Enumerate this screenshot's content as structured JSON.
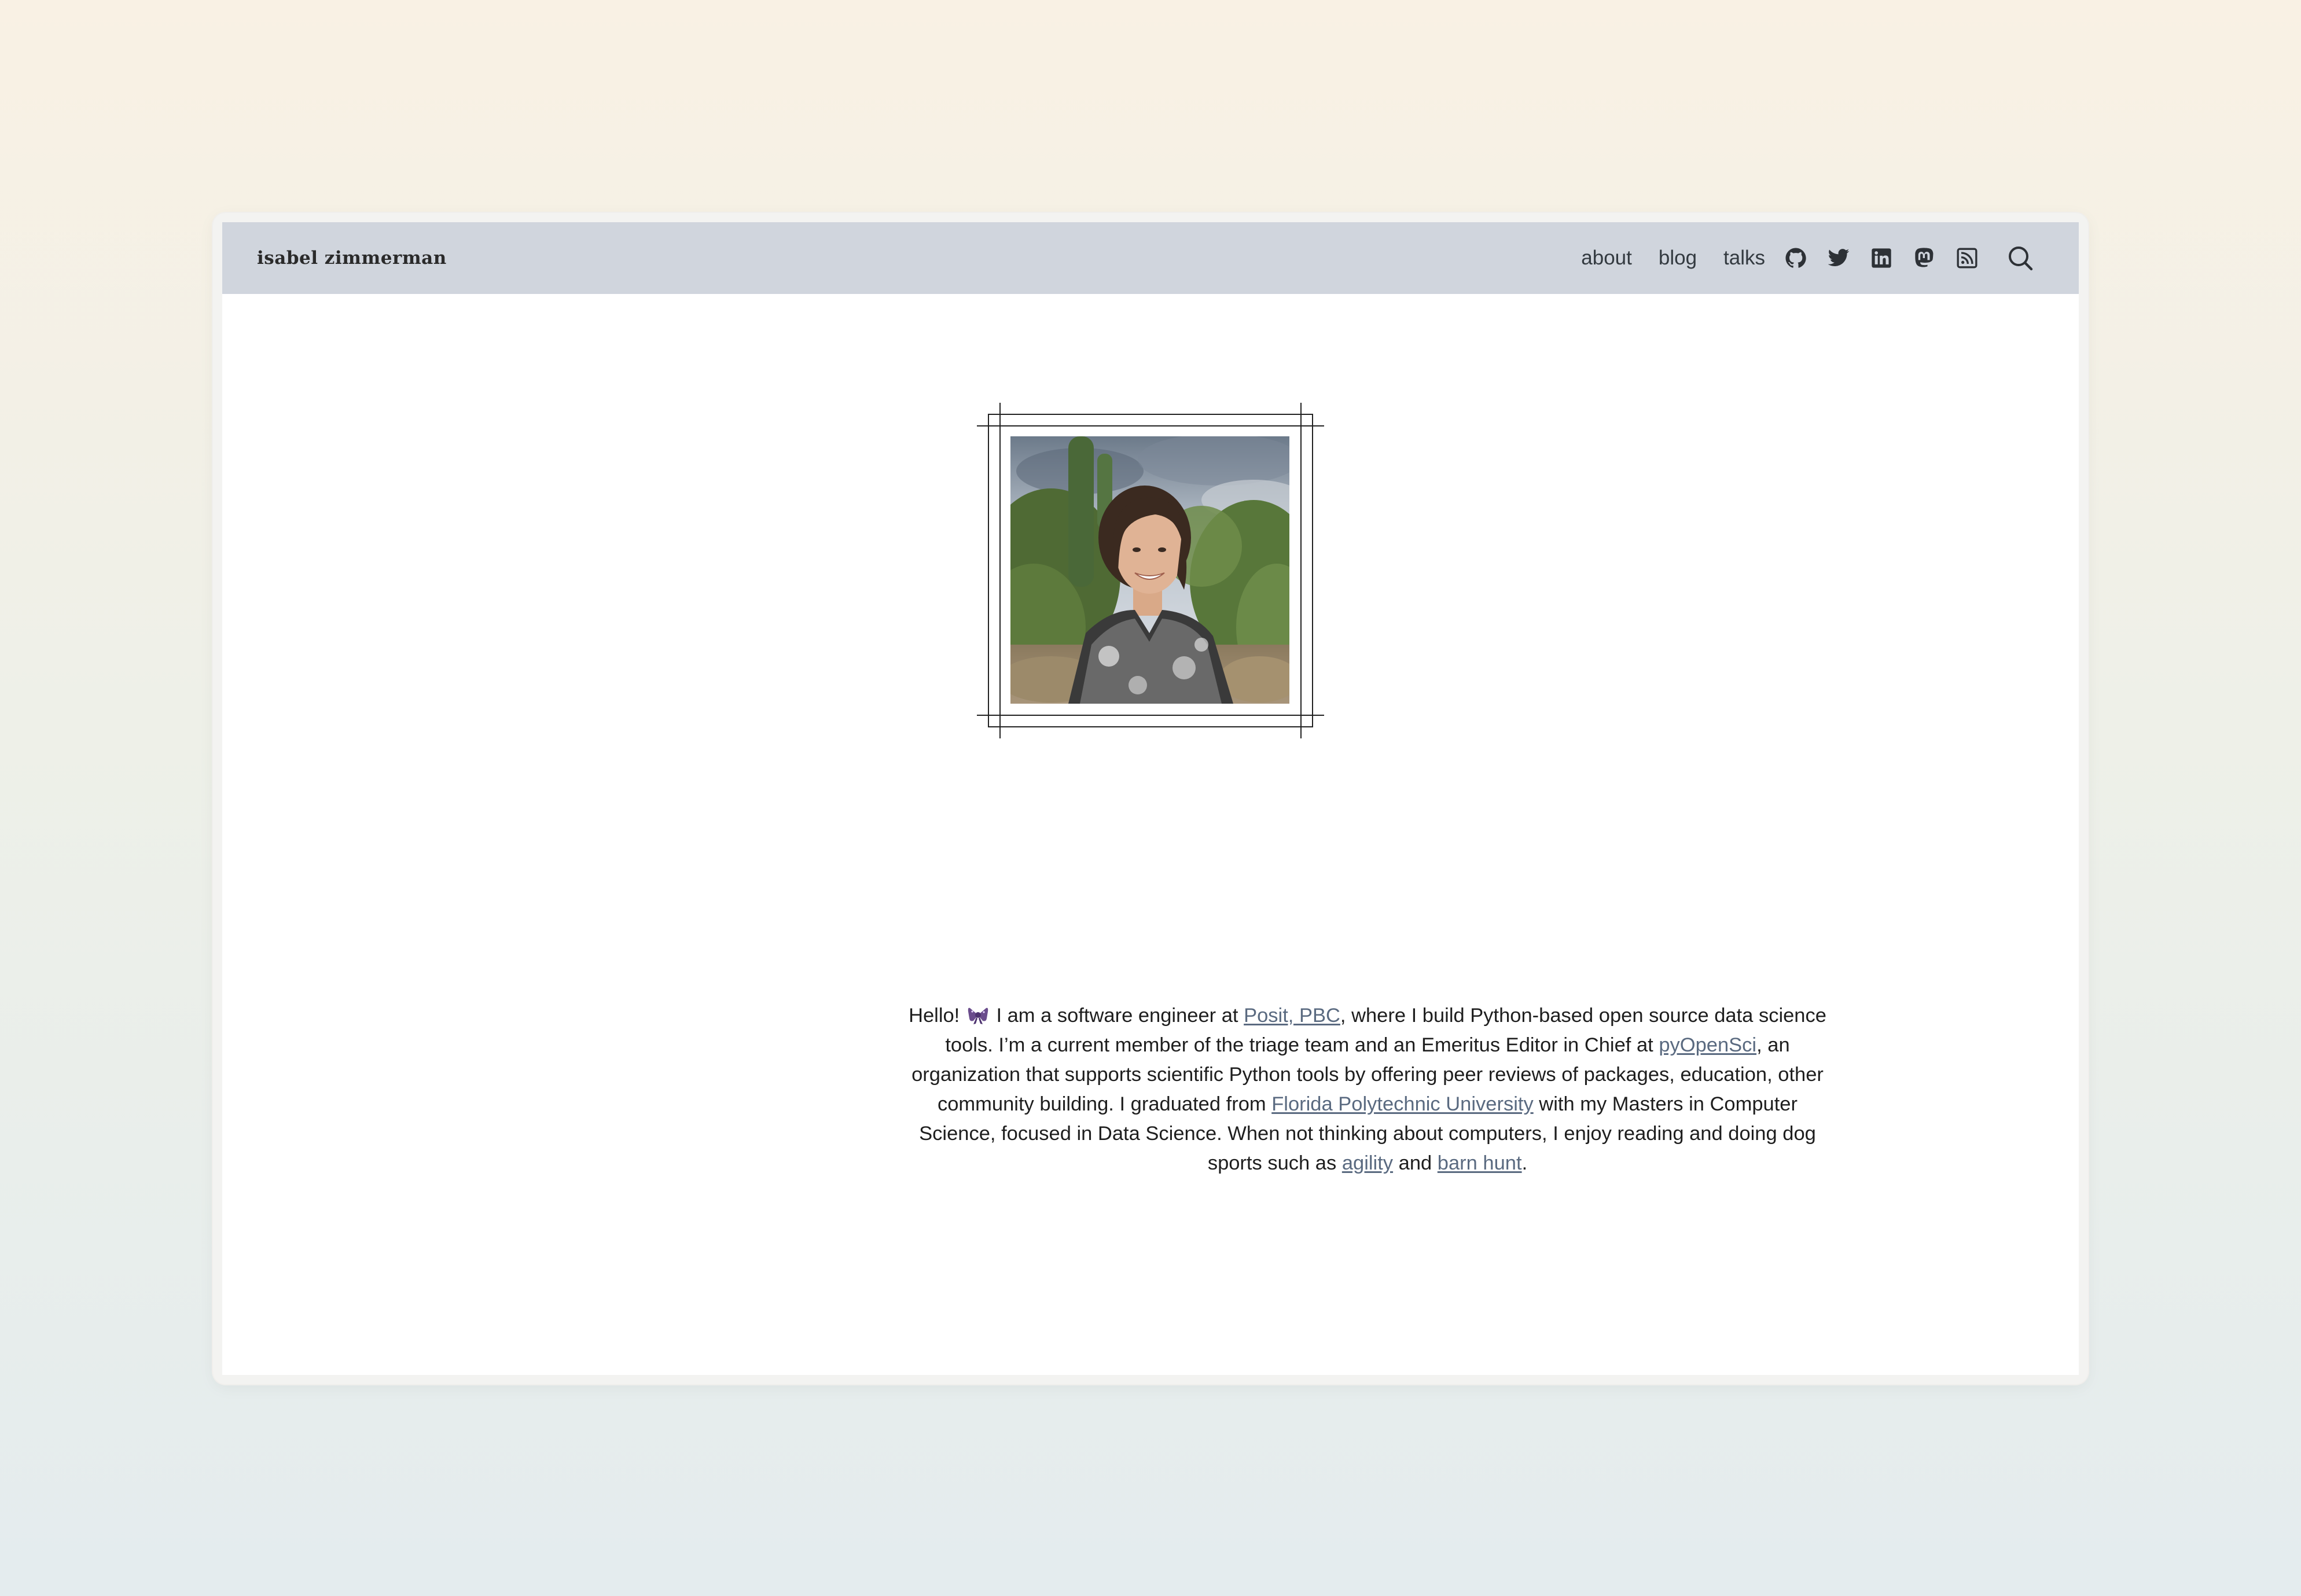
{
  "brand": {
    "name": "isabel zimmerman"
  },
  "nav": {
    "links": [
      {
        "label": "about"
      },
      {
        "label": "blog"
      },
      {
        "label": "talks"
      }
    ],
    "icons": [
      "github-icon",
      "twitter-icon",
      "linkedin-icon",
      "mastodon-icon",
      "rss-icon",
      "search-icon"
    ]
  },
  "profile": {
    "photo_description_icon": "portrait-photo"
  },
  "bio": {
    "p1": "Hello! ",
    "emoji": "sparkly-ribbon-emoji",
    "p2": " I am a software engineer at ",
    "link_posit": "Posit, PBC",
    "p3": ", where I build Python-based open source data science tools. I’m a current member of the triage team and an Emeritus Editor in Chief at ",
    "link_pyopensci": "pyOpenSci",
    "p4": ", an organization that supports scientific Python tools by offering peer reviews of packages, education, other community building. I graduated from ",
    "link_fpu": "Florida Polytechnic University",
    "p5": " with my Masters in Computer Science, focused in Data Science. When not thinking about computers, I enjoy reading and doing dog sports such as ",
    "link_agility": "agility",
    "p6": " and ",
    "link_barnhunt": "barn hunt",
    "p7": "."
  },
  "colors": {
    "navbar_bg": "#d0d5dd",
    "link": "#5a6a80",
    "text": "#1e1e1e"
  }
}
